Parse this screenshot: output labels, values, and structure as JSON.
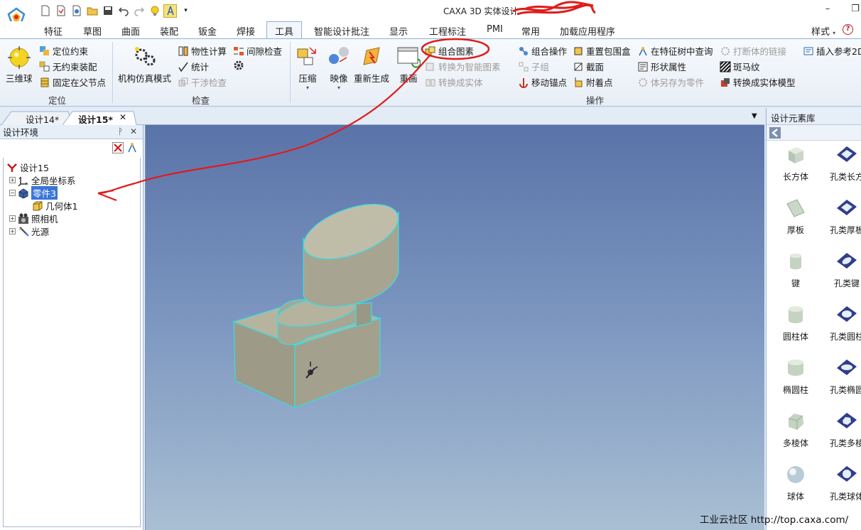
{
  "window": {
    "title": "CAXA 3D 实体设计",
    "minimize_glyph": "–",
    "restore_glyph": "❐"
  },
  "quick_access": [
    "new-icon",
    "new-drawing-icon",
    "open-recent-icon",
    "open-folder-icon",
    "save-icon",
    "undo-icon",
    "redo-icon",
    "bulb-icon",
    "smart-render-icon",
    "customize-dropdown-icon"
  ],
  "ribbon_tabs": [
    "特征",
    "草图",
    "曲面",
    "装配",
    "钣金",
    "焊接",
    "工具",
    "智能设计批注",
    "显示",
    "工程标注",
    "PMI",
    "常用",
    "加载应用程序"
  ],
  "active_tab": "工具",
  "style_menu": "样式",
  "style_menu_arrow": "▾",
  "help_glyph": "?",
  "ribbon": {
    "group_position": {
      "label": "定位",
      "three_ball": "三维球",
      "position_constraint": "定位约束",
      "unconstrained_assembly": "无约束装配",
      "fix_on_parent": "固定在父节点"
    },
    "group_check": {
      "label": "检查",
      "mechanism_sim": "机构仿真模式",
      "property_calc": "物性计算",
      "statistics": "统计",
      "clearance_check": "间隙检查",
      "interference_check": "干涉检查"
    },
    "group_ops": {
      "label": "操作",
      "compress": "压缩",
      "mirror": "映像",
      "regenerate": "重新生成",
      "redraw": "重画",
      "combine_elements": "组合图素",
      "convert_smart": "转换为智能图素",
      "convert_solid": "转换成实体",
      "combine_ops": "组合操作",
      "sub_group": "子组",
      "move_anchor": "移动锚点",
      "reset_bbox": "重置包围盒",
      "section": "截面",
      "attach_point": "附着点",
      "query_in_tree": "在特征树中查询",
      "shape_props": "形状属性",
      "save_as_part": "体另存为零件",
      "break_link": "打断体的链接",
      "zebra": "斑马纹",
      "to_solid_model": "转换成实体模型",
      "insert_ref_2d": "插入参考2D"
    }
  },
  "doc_tabs": [
    "设计14*",
    "设计15*"
  ],
  "doc_tab_close": "✕",
  "doc_tabs_dropdown": "▼",
  "active_doc": "设计15*",
  "left_panel": {
    "title": "设计环境",
    "pin_glyph": "ᚹ",
    "close_glyph": "✕",
    "tree": [
      {
        "label": "设计15",
        "icon": "design-env-icon",
        "indent": 0,
        "expander": ""
      },
      {
        "label": "全局坐标系",
        "icon": "coordinate-system-icon",
        "indent": 1,
        "expander": "+"
      },
      {
        "label": "零件3",
        "icon": "part-icon",
        "indent": 1,
        "expander": "−",
        "selected": true
      },
      {
        "label": "几何体1",
        "icon": "solid-body-icon",
        "indent": 2,
        "expander": ""
      },
      {
        "label": "照相机",
        "icon": "camera-icon",
        "indent": 1,
        "expander": "+"
      },
      {
        "label": "光源",
        "icon": "light-source-icon",
        "indent": 1,
        "expander": "+"
      }
    ]
  },
  "right_panel": {
    "title": "设计元素库",
    "items": [
      "长方体",
      "孔类长方",
      "厚板",
      "孔类厚板",
      "键",
      "孔类键",
      "圆柱体",
      "孔类圆柱",
      "椭圆柱",
      "孔类椭圆",
      "多棱体",
      "孔类多棱",
      "球体",
      "孔类球体"
    ]
  },
  "watermark": "工业云社区 http://top.caxa.com/",
  "colors": {
    "accent_red": "#e01b1b",
    "selection_blue": "#3875d7",
    "model_face": "#b8b6a2",
    "model_edge": "#32e0e6"
  }
}
